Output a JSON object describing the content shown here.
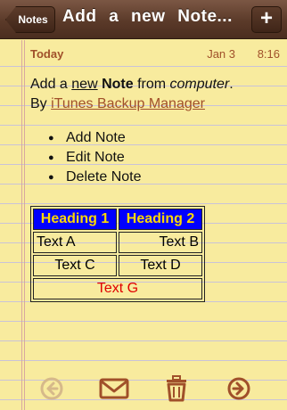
{
  "nav": {
    "back_label": "Notes",
    "title": "Add a new Note...",
    "add_label": "+"
  },
  "note": {
    "date_label": "Today",
    "date": "Jan 3",
    "time": "8:16",
    "line1": {
      "p1": "Add a ",
      "p2": "new",
      "p3": " ",
      "p4": "Note",
      "p5": " from ",
      "p6": "computer",
      "p7": "."
    },
    "line2": {
      "prefix": "By ",
      "link": "iTunes Backup Manager"
    },
    "bullets": [
      "Add Note",
      "Edit Note",
      "Delete Note"
    ],
    "table": {
      "headers": [
        "Heading 1",
        "Heading 2"
      ],
      "row1": [
        "Text A",
        "Text B"
      ],
      "row2": [
        "Text C",
        "Text D"
      ],
      "row3": "Text G"
    }
  },
  "toolbar": {
    "icons": [
      "previous-icon",
      "mail-icon",
      "trash-icon",
      "next-icon"
    ]
  },
  "colors": {
    "accent": "#a0502a",
    "paper": "#f8eb9e",
    "header_bg": "#0000ff",
    "header_text": "#ffd800",
    "red_text": "#e00000"
  }
}
